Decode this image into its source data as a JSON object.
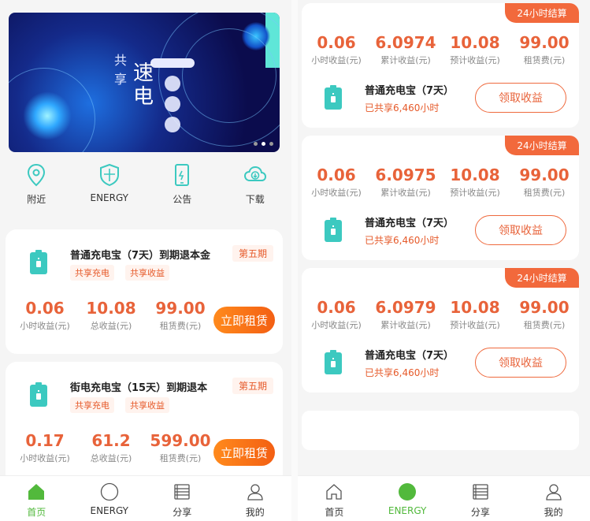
{
  "left": {
    "banner": {
      "char_1": "共",
      "char_2": "享",
      "char_3": "速",
      "char_4": "电"
    },
    "quicknav": [
      {
        "label": "附近",
        "icon": "location-pin-icon"
      },
      {
        "label": "ENERGY",
        "icon": "shield-icon"
      },
      {
        "label": "公告",
        "icon": "phone-notice-icon"
      },
      {
        "label": "下载",
        "icon": "cloud-download-icon"
      }
    ],
    "products": [
      {
        "name": "普通充电宝（7天）到期退本金",
        "period": "第五期",
        "tags": [
          "共享充电",
          "共享收益"
        ],
        "stats": [
          {
            "value": "0.06",
            "label": "小时收益(元)"
          },
          {
            "value": "10.08",
            "label": "总收益(元)"
          },
          {
            "value": "99.00",
            "label": "租赁费(元)"
          }
        ],
        "button": "立即租赁"
      },
      {
        "name": "街电充电宝（15天）到期退本",
        "period": "第五期",
        "tags": [
          "共享充电",
          "共享收益"
        ],
        "stats": [
          {
            "value": "0.17",
            "label": "小时收益(元)"
          },
          {
            "value": "61.2",
            "label": "总收益(元)"
          },
          {
            "value": "599.00",
            "label": "租赁费(元)"
          }
        ],
        "button": "立即租赁"
      }
    ],
    "tabs": [
      {
        "label": "首页",
        "icon": "home-icon",
        "active": true
      },
      {
        "label": "ENERGY",
        "icon": "circle-icon",
        "active": false
      },
      {
        "label": "分享",
        "icon": "list-icon",
        "active": false
      },
      {
        "label": "我的",
        "icon": "user-icon",
        "active": false
      }
    ]
  },
  "right": {
    "cards": [
      {
        "ribbon": "24小时结算",
        "stats": [
          {
            "value": "0.06",
            "label": "小时收益(元)"
          },
          {
            "value": "6.0974",
            "label": "累计收益(元)"
          },
          {
            "value": "10.08",
            "label": "预计收益(元)"
          },
          {
            "value": "99.00",
            "label": "租赁费(元)"
          }
        ],
        "name": "普通充电宝（7天）",
        "shared": "已共享6,460小时",
        "button": "领取收益"
      },
      {
        "ribbon": "24小时结算",
        "stats": [
          {
            "value": "0.06",
            "label": "小时收益(元)"
          },
          {
            "value": "6.0975",
            "label": "累计收益(元)"
          },
          {
            "value": "10.08",
            "label": "预计收益(元)"
          },
          {
            "value": "99.00",
            "label": "租赁费(元)"
          }
        ],
        "name": "普通充电宝（7天）",
        "shared": "已共享6,460小时",
        "button": "领取收益"
      },
      {
        "ribbon": "24小时结算",
        "stats": [
          {
            "value": "0.06",
            "label": "小时收益(元)"
          },
          {
            "value": "6.0979",
            "label": "累计收益(元)"
          },
          {
            "value": "10.08",
            "label": "预计收益(元)"
          },
          {
            "value": "99.00",
            "label": "租赁费(元)"
          }
        ],
        "name": "普通充电宝（7天）",
        "shared": "已共享6,460小时",
        "button": "领取收益"
      }
    ],
    "tabs": [
      {
        "label": "首页",
        "icon": "home-icon",
        "active": false
      },
      {
        "label": "ENERGY",
        "icon": "circle-icon",
        "active": true
      },
      {
        "label": "分享",
        "icon": "list-icon",
        "active": false
      },
      {
        "label": "我的",
        "icon": "user-icon",
        "active": false
      }
    ]
  },
  "colors": {
    "accent_orange": "#e8633a",
    "ribbon": "#f2693c",
    "active_green": "#52b93c",
    "icon_teal": "#3cc9c0"
  }
}
